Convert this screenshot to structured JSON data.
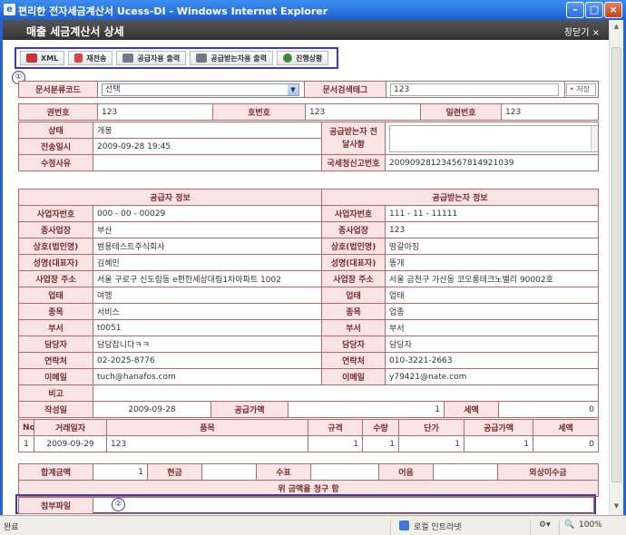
{
  "window": {
    "title": "편리한 전자세금계산서 Ucess-DI - Windows Internet Explorer"
  },
  "header": {
    "title": "매출 세금계산서 상세",
    "close_label": "창닫기 ×"
  },
  "toolbar": {
    "buttons": [
      "XML",
      "재전송",
      "공급자용 출력",
      "공급받는자용 출력",
      "진행상황"
    ]
  },
  "markers": [
    "①",
    "②"
  ],
  "doc": {
    "class_label": "문서분류코드",
    "class_value": "선택",
    "tag_label": "문서검색태그",
    "tag_value": "123",
    "save_label": "• 저장",
    "book_label": "권번호",
    "book_value": "123",
    "ho_label": "호번호",
    "ho_value": "123",
    "serial_label": "일련번호",
    "serial_value": "123"
  },
  "status": {
    "state_label": "상태",
    "state_value": "개봉",
    "sent_label": "전송일시",
    "sent_value": "2009-09-28 19:45",
    "recv_msg_label": "공급받는자 전달사항",
    "edit_label": "수정사유",
    "nts_label": "국세청신고번호",
    "nts_value": "20090928123456781492103​9"
  },
  "parties": {
    "supplier_header": "공급자 정보",
    "receiver_header": "공급받는자 정보",
    "rows": [
      {
        "label": "사업자번호",
        "s": "000 - 00 - 00029",
        "r": "111 - 11 - 11111"
      },
      {
        "label": "종사업장",
        "s": "부산",
        "r": "123"
      },
      {
        "label": "상호(법인명)",
        "s": "범용테스트주식회사",
        "r": "떵갈아징"
      },
      {
        "label": "성명(대표자)",
        "s": "김혜민",
        "r": "똥개"
      },
      {
        "label": "사업장 주소",
        "s": "서울 구로구 신도림동 e편한세상대림1차아파트 1002",
        "r": "서울 금천구 가산동 코오롱테크노밸리 90002호"
      },
      {
        "label": "업태",
        "s": "여행",
        "r": "업태"
      },
      {
        "label": "종목",
        "s": "서비스",
        "r": "업종"
      },
      {
        "label": "부서",
        "s": "t0051",
        "r": "부서"
      },
      {
        "label": "담당자",
        "s": "담당잡니다ㅋㅋ",
        "r": "담당자"
      },
      {
        "label": "연락처",
        "s": "02-2025-8776",
        "r": "010-3221-2663"
      },
      {
        "label": "이메일",
        "s": "tuch@hanafos.com",
        "r": "y79421@nate.com"
      }
    ],
    "memo_label": "비고"
  },
  "summary": {
    "date_label": "작성일",
    "date_value": "2009-09-28",
    "supply_label": "공급가액",
    "supply_value": "1",
    "tax_label": "세액",
    "tax_value": "0"
  },
  "items": {
    "headers": [
      "No",
      "거래일자",
      "품목",
      "규격",
      "수량",
      "단가",
      "공급가액",
      "세액"
    ],
    "rows": [
      [
        "1",
        "2009-09-29",
        "123",
        "1",
        "1",
        "1",
        "1",
        "0"
      ]
    ]
  },
  "totals": {
    "total_label": "합계금액",
    "total_value": "1",
    "cash_label": "현금",
    "check_label": "수표",
    "note_label": "어음",
    "credit_label": "외상미수금",
    "claim_text": "위 금액을 청구 함",
    "attach_label": "첨부파일"
  },
  "statusbar": {
    "left": "완료",
    "zone": "로컬 인트라넷",
    "zoom": "100%"
  }
}
